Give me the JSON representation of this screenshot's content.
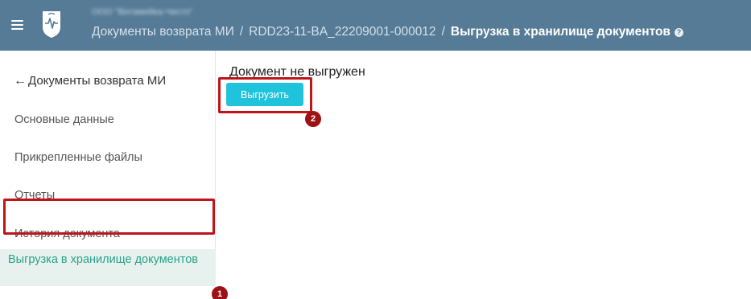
{
  "header": {
    "org_name": "ООО \"Витамейка-Чисто\"",
    "breadcrumb": {
      "parent": "Документы возврата МИ",
      "separator": "/",
      "document": "RDD23-11-BA_22209001-000012",
      "current": "Выгрузка в хранилище документов"
    },
    "help_glyph": "?"
  },
  "sidebar": {
    "back_label": "Документы возврата МИ",
    "back_arrow": "←",
    "items": [
      {
        "label": "Основные данные"
      },
      {
        "label": "Прикрепленные файлы"
      },
      {
        "label": "Отчеты"
      },
      {
        "label": "История документа"
      },
      {
        "label": "Выгрузка в хранилище документов"
      }
    ]
  },
  "main": {
    "status_text": "Документ не выгружен",
    "upload_button_label": "Выгрузить"
  },
  "annotations": {
    "marker_1": "1",
    "marker_2": "2",
    "marker_color": "#c0141b"
  },
  "colors": {
    "header_bg": "#557b96",
    "active_item_bg": "#e7f2ee",
    "active_item_text": "#27a189",
    "button_bg": "#1fc3dc"
  }
}
